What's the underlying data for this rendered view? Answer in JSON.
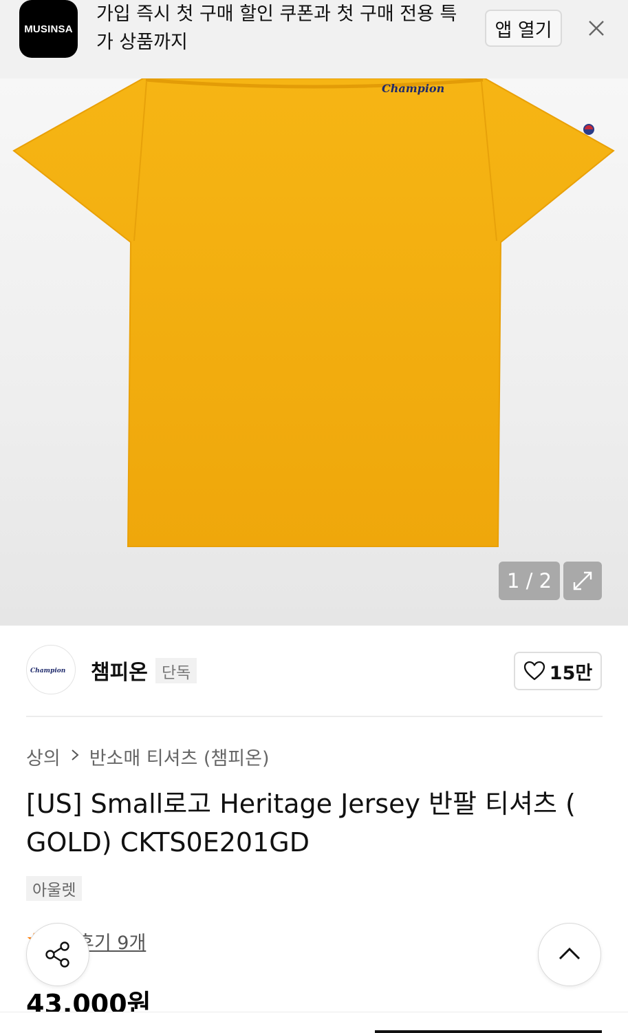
{
  "banner": {
    "app_icon_text": "MUSINSA",
    "message": "가입 즉시 첫 구매 할인 쿠폰과 첫 구매 전용 특가 상품까지",
    "open_app_label": "앱 열기",
    "close_icon": "close-icon"
  },
  "gallery": {
    "counter": "1 / 2",
    "expand_icon": "expand-icon",
    "product_color": "#f4ae12",
    "print_text": "Champion"
  },
  "brand": {
    "logo_text": "Champion",
    "name": "챔피온",
    "badge": "단독",
    "like_icon": "heart-icon",
    "like_count": "15만"
  },
  "breadcrumb": {
    "items": [
      "상의",
      "반소매 티셔츠 (챔피온)"
    ],
    "separator_icon": "chevron-right-icon"
  },
  "product": {
    "title": "[US] Small로고 Heritage Jersey 반팔 티셔츠 ( GOLD) CKTS0E201GD",
    "tag": "아울렛",
    "review_link": "후기 9개",
    "price": "43,000원"
  },
  "floating": {
    "share_icon": "share-icon",
    "scroll_top_icon": "chevron-up-icon"
  },
  "colors": {
    "accent": "#ff7a00",
    "shirt": "#f4ae12",
    "badge_bg": "#f1f1f1"
  }
}
